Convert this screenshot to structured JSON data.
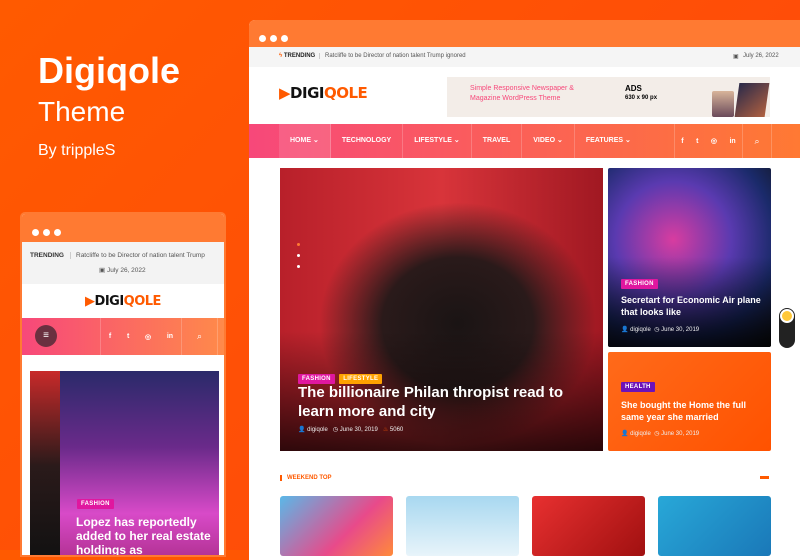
{
  "promo": {
    "title": "Digiqole",
    "subtitle": "Theme",
    "author": "By trippleS"
  },
  "desktop": {
    "trending_label": "TRENDING",
    "trending_text": "Ratcliffe to be Director of nation talent Trump ignored",
    "date": "July 26, 2022",
    "logo": {
      "part1": "DIGI",
      "part2": "QOLE"
    },
    "ad": {
      "text": "Simple Responsive Newspaper & Magazine WordPress Theme",
      "label": "ADS",
      "size": "630 x 90 px"
    },
    "nav": [
      {
        "label": "HOME",
        "dropdown": true
      },
      {
        "label": "TECHNOLOGY"
      },
      {
        "label": "LIFESTYLE",
        "dropdown": true
      },
      {
        "label": "TRAVEL"
      },
      {
        "label": "VIDEO",
        "dropdown": true
      },
      {
        "label": "FEATURES",
        "dropdown": true
      }
    ],
    "social": [
      "f",
      "t",
      "ig",
      "in"
    ],
    "hero": {
      "tags": [
        "FASHION",
        "LIFESTYLE"
      ],
      "title": "The billionaire Philan thropist read to learn more and city",
      "author": "digiqole",
      "date": "June 30, 2019",
      "views": "5060"
    },
    "card1": {
      "tag": "FASHION",
      "title": "Secretart for Economic Air plane that looks like",
      "author": "digiqole",
      "date": "June 30, 2019"
    },
    "card2": {
      "tag": "HEALTH",
      "title": "She bought the Home the full same year she married",
      "author": "digiqole",
      "date": "June 30, 2019"
    },
    "section_title": "WEEKEND TOP"
  },
  "mobile": {
    "trending_label": "TRENDING",
    "trending_text": "Ratcliffe to be Director of nation talent Trump",
    "date": "July 26, 2022",
    "tag": "FASHION",
    "title": "Lopez has reportedly added to her real estate holdings as"
  },
  "colors": {
    "accent": "#ff5a00",
    "pink": "#f7487a",
    "fashion": "#e0179f",
    "lifestyle": "#ffa200",
    "health": "#6c12b8"
  }
}
